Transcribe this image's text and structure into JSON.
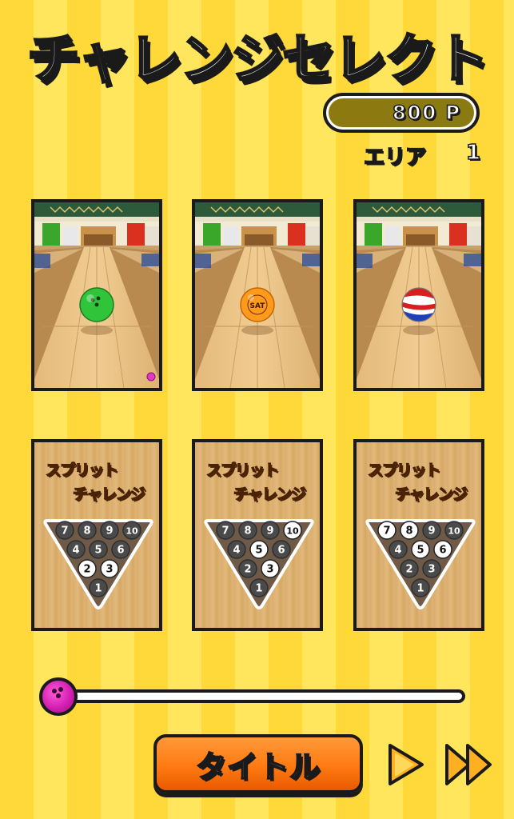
{
  "header": {
    "title": "チャレンジセレクト",
    "points": "800 P",
    "area_label": "エリア",
    "area_number": "1"
  },
  "lanes": [
    {
      "ball_color": "#2fc43a",
      "ball_icon": "green-ball-icon"
    },
    {
      "ball_color": "#ff9a1a",
      "ball_icon": "orange-sat-ball-icon",
      "ball_text": "SAT"
    },
    {
      "ball_color": "#ffffff",
      "ball_icon": "tricolor-ball-icon"
    }
  ],
  "challenges": [
    {
      "line1": "スプリット",
      "line2": "チャレンジ",
      "remaining_pins": [
        2,
        3
      ]
    },
    {
      "line1": "スプリット",
      "line2": "チャレンジ",
      "remaining_pins": [
        3,
        5,
        10
      ]
    },
    {
      "line1": "スプリット",
      "line2": "チャレンジ",
      "remaining_pins": [
        5,
        6,
        7,
        8
      ]
    }
  ],
  "slider": {
    "position": 0.0
  },
  "footer": {
    "title_button": "タイトル",
    "next_icon": "play-icon",
    "fast_forward_icon": "fast-forward-icon"
  },
  "colors": {
    "accent_orange": "#ff7a12",
    "knob_magenta": "#d31fb2",
    "stripe_light": "#ffe65c",
    "stripe_dark": "#ffd83a"
  }
}
